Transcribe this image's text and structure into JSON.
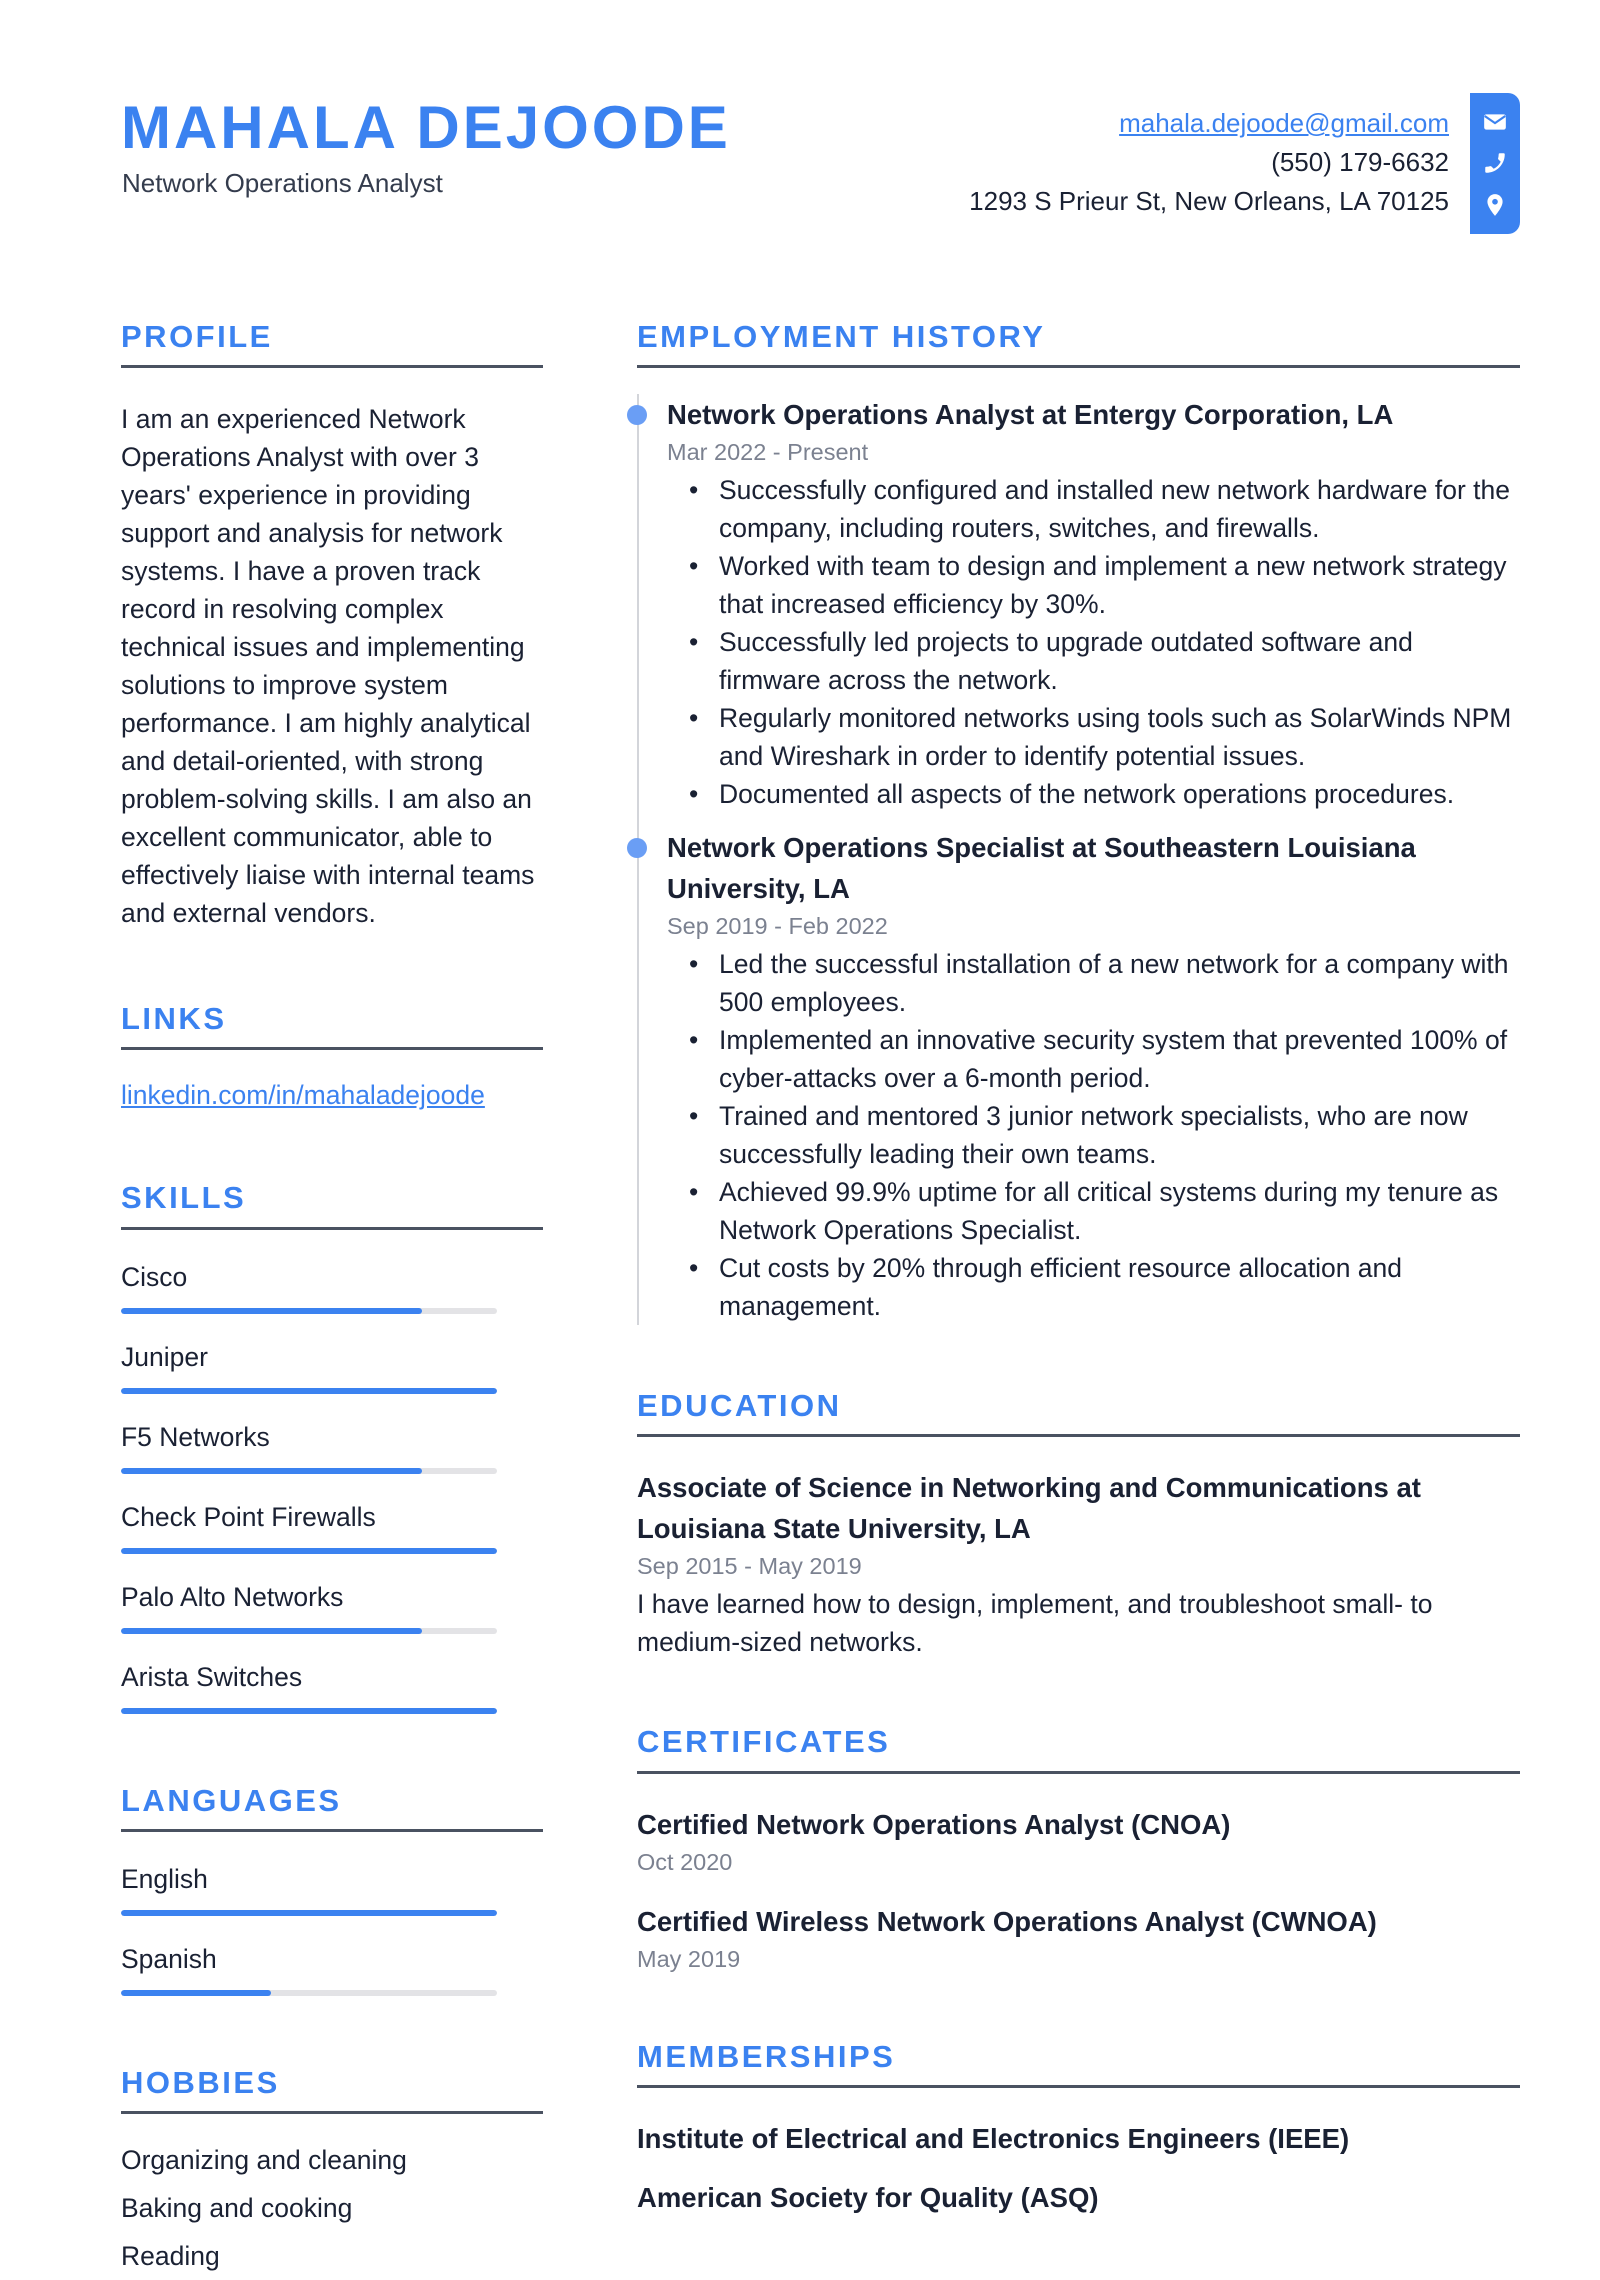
{
  "header": {
    "name": "MAHALA DEJOODE",
    "title": "Network Operations Analyst",
    "contact": {
      "email": "mahala.dejoode@gmail.com",
      "phone": "(550) 179-6632",
      "address": "1293 S Prieur St, New Orleans, LA 70125"
    },
    "icons": [
      "envelope-icon",
      "phone-icon",
      "map-pin-icon"
    ],
    "accent_color": "#3b82f0"
  },
  "profile": {
    "heading": "PROFILE",
    "text": "I am an experienced Network Operations Analyst with over 3 years' experience in providing support and analysis for network systems. I have a proven track record in resolving complex technical issues and implementing solutions to improve system performance. I am highly analytical and detail-oriented, with strong problem-solving skills. I am also an excellent communicator, able to effectively liaise with internal teams and external vendors."
  },
  "links": {
    "heading": "LINKS",
    "items": [
      "linkedin.com/in/mahaladejoode"
    ]
  },
  "skills": {
    "heading": "SKILLS",
    "items": [
      {
        "label": "Cisco",
        "level": 0.8
      },
      {
        "label": "Juniper",
        "level": 1.0
      },
      {
        "label": "F5 Networks",
        "level": 0.8
      },
      {
        "label": "Check Point Firewalls",
        "level": 1.0
      },
      {
        "label": "Palo Alto Networks",
        "level": 0.8
      },
      {
        "label": "Arista Switches",
        "level": 1.0
      }
    ]
  },
  "languages": {
    "heading": "LANGUAGES",
    "items": [
      {
        "label": "English",
        "level": 1.0
      },
      {
        "label": "Spanish",
        "level": 0.4
      }
    ]
  },
  "hobbies": {
    "heading": "HOBBIES",
    "items": [
      "Organizing and cleaning",
      "Baking and cooking",
      "Reading"
    ]
  },
  "employment": {
    "heading": "EMPLOYMENT HISTORY",
    "jobs": [
      {
        "title": "Network Operations Analyst at Entergy Corporation, LA",
        "dates": "Mar 2022 - Present",
        "bullets": [
          "Successfully configured and installed new network hardware for the company, including routers, switches, and firewalls.",
          "Worked with team to design and implement a new network strategy that increased efficiency by 30%.",
          "Successfully led projects to upgrade outdated software and firmware across the network.",
          "Regularly monitored networks using tools such as SolarWinds NPM and Wireshark in order to identify potential issues.",
          "Documented all aspects of the network operations procedures."
        ]
      },
      {
        "title": "Network Operations Specialist at Southeastern Louisiana University, LA",
        "dates": "Sep 2019 - Feb 2022",
        "bullets": [
          "Led the successful installation of a new network for a company with 500 employees.",
          "Implemented an innovative security system that prevented 100% of cyber-attacks over a 6-month period.",
          "Trained and mentored 3 junior network specialists, who are now successfully leading their own teams.",
          "Achieved 99.9% uptime for all critical systems during my tenure as Network Operations Specialist.",
          "Cut costs by 20% through efficient resource allocation and management."
        ]
      }
    ]
  },
  "education": {
    "heading": "EDUCATION",
    "items": [
      {
        "title": "Associate of Science in Networking and Communications at Louisiana State University, LA",
        "dates": "Sep 2015 - May 2019",
        "description": "I have learned how to design, implement, and troubleshoot small- to medium-sized networks."
      }
    ]
  },
  "certificates": {
    "heading": "CERTIFICATES",
    "items": [
      {
        "title": "Certified Network Operations Analyst (CNOA)",
        "date": "Oct 2020"
      },
      {
        "title": "Certified Wireless Network Operations Analyst (CWNOA)",
        "date": "May 2019"
      }
    ]
  },
  "memberships": {
    "heading": "MEMBERSHIPS",
    "items": [
      "Institute of Electrical and Electronics Engineers (IEEE)",
      "American Society for Quality (ASQ)"
    ]
  }
}
